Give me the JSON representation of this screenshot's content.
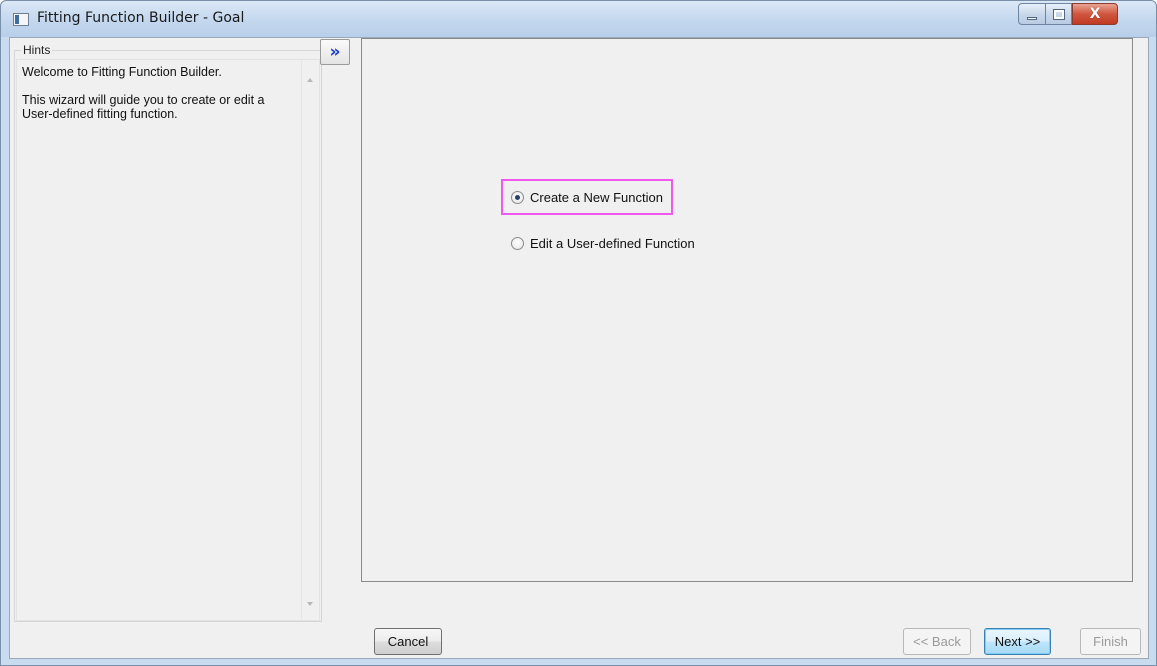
{
  "window": {
    "title": "Fitting Function Builder - Goal",
    "icon": "app-window-icon",
    "controls": {
      "minimize": "minimize-icon",
      "maximize": "maximize-icon",
      "close": "X"
    }
  },
  "hints": {
    "label": "Hints",
    "paragraphs": [
      "Welcome to Fitting Function Builder.",
      "This wizard will guide you to create or edit a User-defined fitting function."
    ]
  },
  "expand_button": {
    "glyph": "»",
    "icon": "double-chevron-right-icon"
  },
  "options": [
    {
      "label": "Create a New Function",
      "checked": true,
      "highlighted": true
    },
    {
      "label": "Edit a User-defined Function",
      "checked": false,
      "highlighted": false
    }
  ],
  "buttons": {
    "cancel": "Cancel",
    "back": "<< Back",
    "next": "Next >>",
    "finish": "Finish"
  },
  "button_states": {
    "back_enabled": false,
    "finish_enabled": false,
    "next_default": true
  },
  "colors": {
    "highlight_border": "#f058f0",
    "expand_glyph": "#1c3fd0"
  }
}
